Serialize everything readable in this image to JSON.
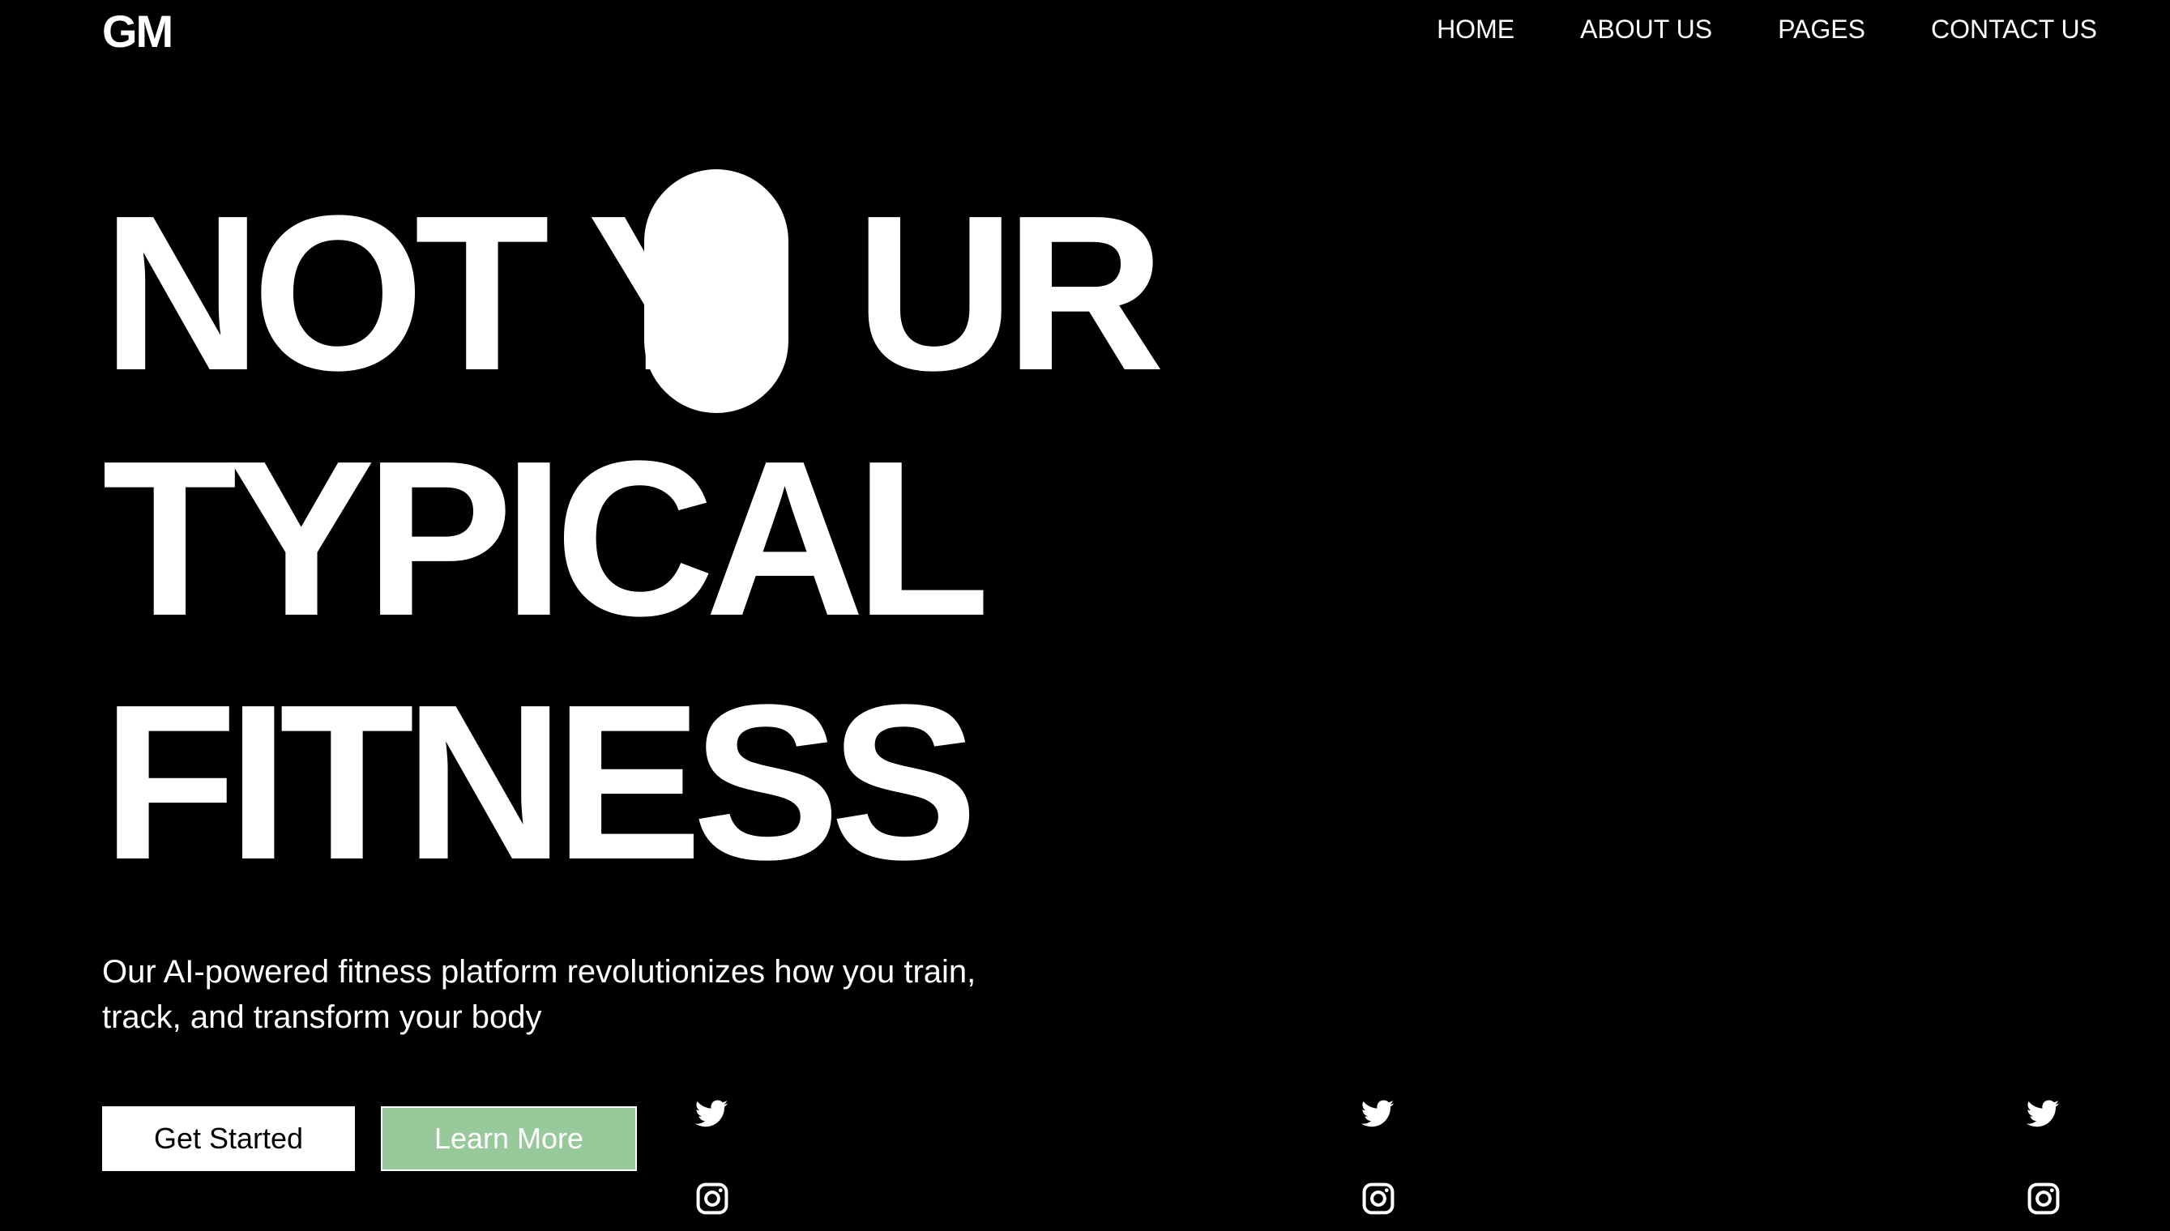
{
  "header": {
    "logo": "GM",
    "nav": [
      "HOME",
      "ABOUT US",
      "PAGES",
      "CONTACT US"
    ]
  },
  "hero": {
    "line1_part1": "NOT Y",
    "line1_part2": "UR",
    "line2": "TYPICAL",
    "line3": "FITNESS",
    "subtitle": "Our AI-powered fitness platform revolutionizes how you train, track, and transform your body"
  },
  "buttons": {
    "get_started": "Get Started",
    "learn_more": "Learn More"
  },
  "social": {
    "icons": [
      "twitter-icon",
      "instagram-icon"
    ],
    "groups": 3
  },
  "colors": {
    "background": "#000000",
    "text": "#ffffff",
    "accent": "#98c99a"
  }
}
